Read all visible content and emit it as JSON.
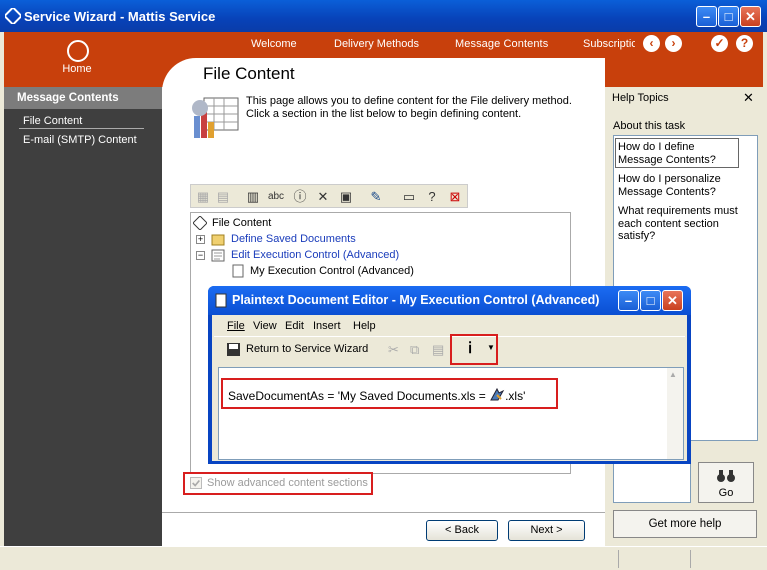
{
  "window": {
    "title": "Service Wizard - Mattis Service"
  },
  "header": {
    "home_label": "Home",
    "tabs": [
      {
        "label": "Welcome"
      },
      {
        "label": "Delivery Methods"
      },
      {
        "label": "Message Contents",
        "active": true
      },
      {
        "label": "Subscriptic"
      }
    ]
  },
  "sidebar": {
    "heading": "Message Contents",
    "items": [
      {
        "label": "File Content",
        "selected": true
      },
      {
        "label": "E-mail (SMTP) Content"
      }
    ]
  },
  "main": {
    "title": "File Content",
    "description": "This page allows you to define content for the File delivery method. Click a section in the list below to begin defining content.",
    "tree": [
      {
        "label": "File Content"
      },
      {
        "label": "Define Saved Documents"
      },
      {
        "label": "Edit Execution Control (Advanced)"
      },
      {
        "label": "My Execution Control (Advanced)"
      }
    ],
    "advanced_checkbox": {
      "label": "Show advanced content sections",
      "checked": true,
      "enabled": false
    },
    "back_label": "< Back",
    "next_label": "Next >"
  },
  "help": {
    "heading": "Help Topics",
    "about_label": "About this task",
    "topics": [
      "How do I define Message Contents?",
      "How do I personalize Message Contents?",
      "What requirements must each content section satisfy?"
    ],
    "go_label": "Go",
    "more_label": "Get more help"
  },
  "editor": {
    "title": "Plaintext Document Editor - My Execution Control (Advanced)",
    "menus": [
      "File",
      "View",
      "Edit",
      "Insert",
      "Help"
    ],
    "return_label": "Return to Service Wizard",
    "code_text_before": "SaveDocumentAs = 'My Saved Documents.xls = ",
    "code_text_after": ".xls'"
  },
  "colors": {
    "accent": "#c8400c",
    "highlight": "#d81e1e",
    "titlebar": "#0a5fd8"
  }
}
